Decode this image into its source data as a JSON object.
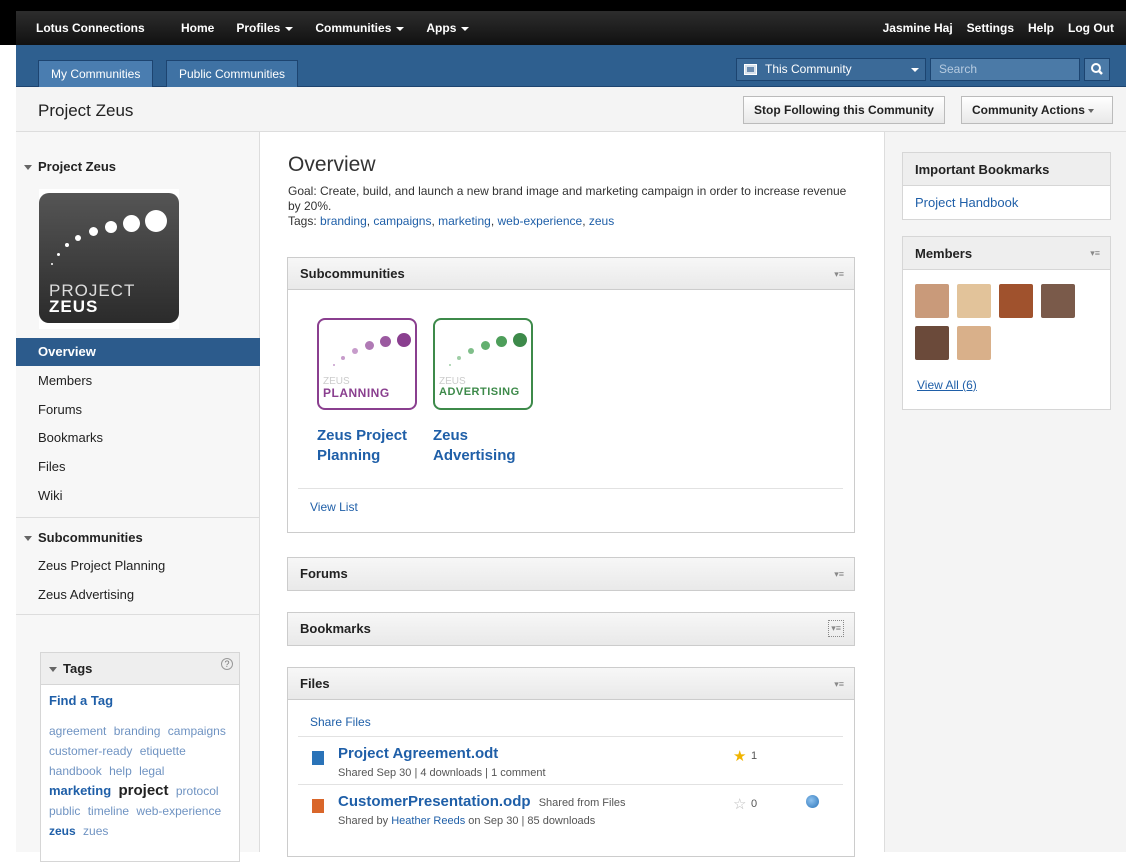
{
  "topbar": {
    "brand": "Lotus Connections",
    "nav": [
      "Home",
      "Profiles",
      "Communities",
      "Apps"
    ],
    "user": "Jasmine Haj",
    "links": [
      "Settings",
      "Help",
      "Log Out"
    ]
  },
  "subnav": {
    "tabs": [
      "My Communities",
      "Public Communities"
    ],
    "scope": "This Community",
    "search_placeholder": "Search"
  },
  "titlebar": {
    "title": "Project Zeus",
    "stop_following": "Stop Following this Community",
    "community_actions": "Community Actions"
  },
  "left": {
    "section_title": "Project Zeus",
    "logo": {
      "line1": "PROJECT",
      "line2": "ZEUS"
    },
    "nav": [
      "Overview",
      "Members",
      "Forums",
      "Bookmarks",
      "Files",
      "Wiki"
    ],
    "subcommunities_title": "Subcommunities",
    "subcommunities": [
      "Zeus Project Planning",
      "Zeus Advertising"
    ],
    "tags_title": "Tags",
    "help_icon": "?",
    "find_tag": "Find a Tag",
    "tags": [
      "agreement",
      "branding",
      "campaigns",
      "customer-ready",
      "etiquette",
      "handbook",
      "help",
      "legal",
      "marketing",
      "project",
      "protocol",
      "public",
      "timeline",
      "web-experience",
      "zeus",
      "zues"
    ]
  },
  "main": {
    "title": "Overview",
    "goal": "Goal: Create, build, and launch a new brand image and marketing campaign in order to increase revenue by 20%.",
    "tags_label": "Tags:",
    "tags": [
      "branding",
      "campaigns",
      "marketing",
      "web-experience",
      "zeus"
    ],
    "subcommunities": {
      "title": "Subcommunities",
      "items": [
        {
          "logo_small": "ZEUS",
          "logo_big": "PLANNING",
          "name_line1": "Zeus Project",
          "name_line2": "Planning",
          "color": "#8a3f8f"
        },
        {
          "logo_small": "ZEUS",
          "logo_big": "ADVERTISING",
          "name_line1": "Zeus",
          "name_line2": "Advertising",
          "color": "#3d8a4a"
        }
      ],
      "view_list": "View List"
    },
    "forums_title": "Forums",
    "bookmarks_title": "Bookmarks",
    "files": {
      "title": "Files",
      "share": "Share Files",
      "items": [
        {
          "name": "Project Agreement.odt",
          "meta": "Shared Sep 30 | 4 downloads | 1 comment",
          "rating": "1",
          "shared_from": "",
          "icon_color": "#2a73b8"
        },
        {
          "name": "CustomerPresentation.odp",
          "shared_from": "Shared from Files",
          "meta_prefix": "Shared by",
          "meta_user": "Heather Reeds",
          "meta_suffix": "on Sep 30 | 85 downloads",
          "rating": "0",
          "icon_color": "#d9662a"
        }
      ]
    }
  },
  "right": {
    "bookmarks_title": "Important Bookmarks",
    "bookmark": "Project Handbook",
    "members_title": "Members",
    "view_all": "View All (6)",
    "member_colors": [
      "#c99a7a",
      "#e2c39a",
      "#a0522d",
      "#7a5a4a",
      "#6b4a3a",
      "#d9b08a"
    ]
  }
}
